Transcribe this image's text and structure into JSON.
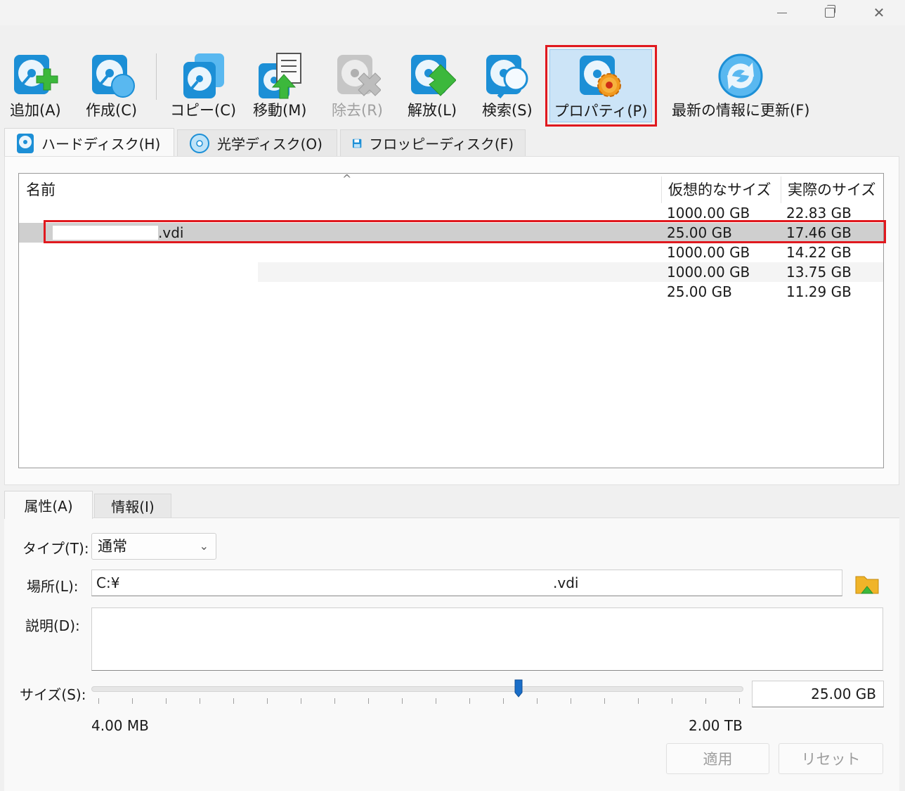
{
  "toolbar": {
    "add": "追加(A)",
    "create": "作成(C)",
    "copy": "コピー(C)",
    "move": "移動(M)",
    "remove": "除去(R)",
    "release": "解放(L)",
    "search": "検索(S)",
    "properties": "プロパティ(P)",
    "refresh": "最新の情報に更新(F)"
  },
  "tabs": {
    "hard_disk": "ハードディスク(H)",
    "optical_disk": "光学ディスク(O)",
    "floppy_disk": "フロッピーディスク(F)"
  },
  "list": {
    "columns": {
      "name": "名前",
      "virtual_size": "仮想的なサイズ",
      "actual_size": "実際のサイズ"
    },
    "rows": [
      {
        "name": "",
        "virtual_size": "1000.00 GB",
        "actual_size": "22.83 GB"
      },
      {
        "name": ".vdi",
        "virtual_size": "25.00 GB",
        "actual_size": "17.46 GB"
      },
      {
        "name": "",
        "virtual_size": "1000.00 GB",
        "actual_size": "14.22 GB"
      },
      {
        "name": "",
        "virtual_size": "1000.00 GB",
        "actual_size": "13.75 GB"
      },
      {
        "name": "",
        "virtual_size": "25.00 GB",
        "actual_size": "11.29 GB"
      }
    ],
    "selected_index": 1
  },
  "details_tabs": {
    "attributes": "属性(A)",
    "info": "情報(I)"
  },
  "form": {
    "type_label": "タイプ(T):",
    "type_value": "通常",
    "location_label": "場所(L):",
    "location_value_prefix": "C:¥",
    "location_value_suffix": ".vdi",
    "description_label": "説明(D):",
    "description_value": "",
    "size_label": "サイズ(S):",
    "size_value": "25.00 GB",
    "size_min": "4.00 MB",
    "size_max": "2.00 TB",
    "size_slider_fraction": 0.655
  },
  "buttons": {
    "apply": "適用",
    "reset": "リセット"
  },
  "colors": {
    "highlight": "#e0191f",
    "selected_row": "#cfcfcf",
    "icon_blue": "#1c8fd6",
    "accent_green": "#3cb83c",
    "gear_orange": "#f29a1f"
  }
}
